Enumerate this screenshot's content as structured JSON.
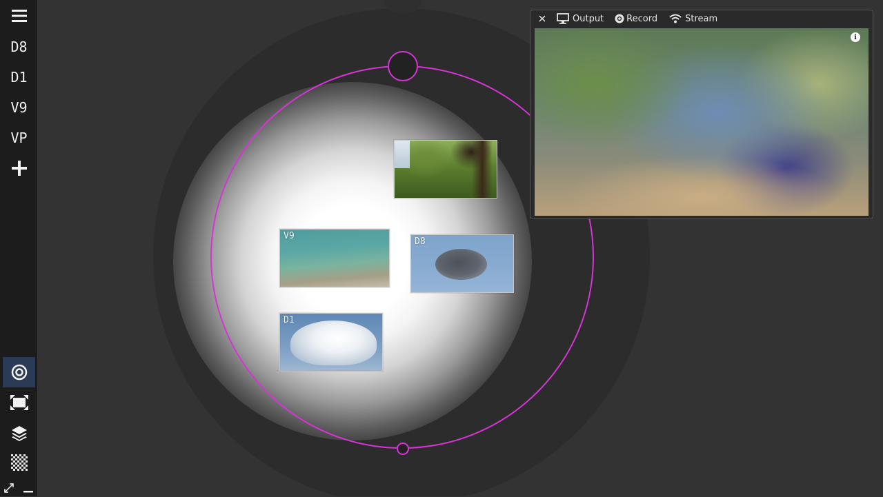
{
  "sidebar": {
    "items": [
      {
        "label": "D8"
      },
      {
        "label": "D1"
      },
      {
        "label": "V9"
      },
      {
        "label": "VP"
      }
    ]
  },
  "canvas": {
    "ring_color": "#d535d5",
    "thumbnails": [
      {
        "label": ""
      },
      {
        "label": "V9"
      },
      {
        "label": "D8"
      },
      {
        "label": "D1"
      }
    ]
  },
  "output_panel": {
    "output_label": "Output",
    "record_label": "Record",
    "stream_label": "Stream",
    "info_glyph": "i"
  }
}
